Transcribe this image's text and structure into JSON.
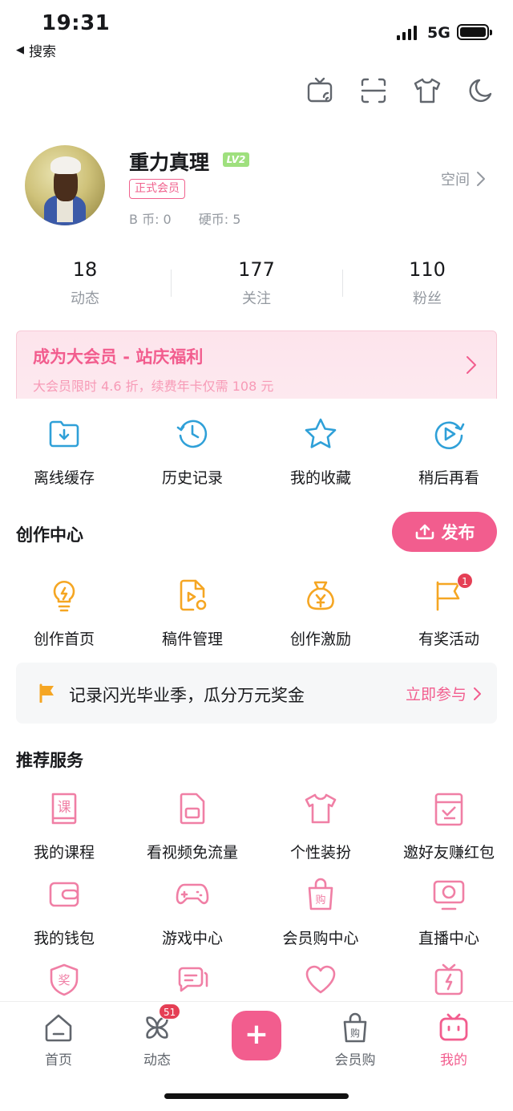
{
  "status_bar": {
    "time": "19:31",
    "back_label": "搜索",
    "network": "5G"
  },
  "profile": {
    "username": "重力真理",
    "level": "LV2",
    "member_tag": "正式会员",
    "b_coin": "B 币: 0",
    "coin": "硬币: 5",
    "space_label": "空间"
  },
  "stats": [
    {
      "num": "18",
      "label": "动态"
    },
    {
      "num": "177",
      "label": "关注"
    },
    {
      "num": "110",
      "label": "粉丝"
    }
  ],
  "vip_banner": {
    "title": "成为大会员 - 站庆福利",
    "subtitle": "大会员限时 4.6 折，续费年卡仅需 108 元"
  },
  "quick_actions": [
    {
      "label": "离线缓存",
      "icon": "download-icon"
    },
    {
      "label": "历史记录",
      "icon": "history-icon"
    },
    {
      "label": "我的收藏",
      "icon": "star-icon"
    },
    {
      "label": "稍后再看",
      "icon": "watch-later-icon"
    }
  ],
  "creation": {
    "title": "创作中心",
    "publish_label": "发布",
    "items": [
      {
        "label": "创作首页",
        "icon": "lightbulb-icon"
      },
      {
        "label": "稿件管理",
        "icon": "manuscript-icon"
      },
      {
        "label": "创作激励",
        "icon": "money-bag-icon"
      },
      {
        "label": "有奖活动",
        "icon": "flag-icon",
        "badge": "1"
      }
    ]
  },
  "promo": {
    "text": "记录闪光毕业季，瓜分万元奖金",
    "link": "立即参与"
  },
  "services": {
    "title": "推荐服务",
    "items": [
      {
        "label": "我的课程",
        "icon": "course-icon"
      },
      {
        "label": "看视频免流量",
        "icon": "sim-card-icon"
      },
      {
        "label": "个性装扮",
        "icon": "tshirt-icon"
      },
      {
        "label": "邀好友赚红包",
        "icon": "invite-icon"
      },
      {
        "label": "我的钱包",
        "icon": "wallet-icon"
      },
      {
        "label": "游戏中心",
        "icon": "gamepad-icon"
      },
      {
        "label": "会员购中心",
        "icon": "shopping-bag-icon"
      },
      {
        "label": "直播中心",
        "icon": "live-icon"
      }
    ]
  },
  "bottom_nav": {
    "items": [
      {
        "label": "首页",
        "icon": "home-icon"
      },
      {
        "label": "动态",
        "icon": "pinwheel-icon",
        "badge": "51"
      },
      {
        "label": "会员购",
        "icon": "shopping-bag-icon"
      },
      {
        "label": "我的",
        "icon": "tv-face-icon"
      }
    ]
  },
  "colors": {
    "accent": "#f25d8e",
    "blue": "#2fa0d8",
    "gold": "#f5a623",
    "gray": "#9499a0"
  }
}
